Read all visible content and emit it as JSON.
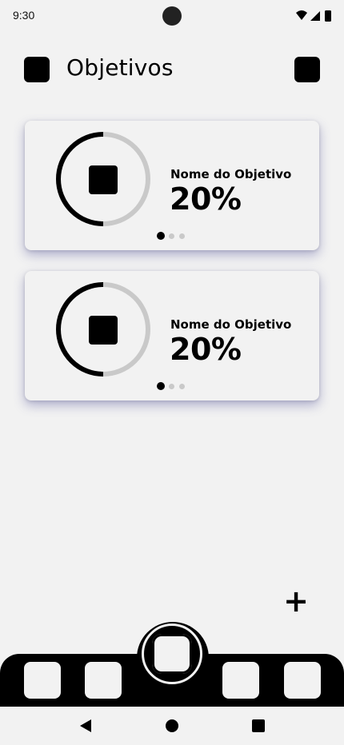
{
  "status_bar": {
    "time": "9:30",
    "icons": [
      "wifi-icon",
      "signal-icon",
      "battery-icon"
    ]
  },
  "header": {
    "title": "Objetivos",
    "menu_icon": "square-icon",
    "action_icon": "square-icon"
  },
  "goals": [
    {
      "name": "Nome do Objetivo",
      "percent_label": "20%",
      "progress": 0.2,
      "icon": "square-icon",
      "dots": {
        "count": 3,
        "active": 0
      }
    },
    {
      "name": "Nome do Objetivo",
      "percent_label": "20%",
      "progress": 0.2,
      "icon": "square-icon",
      "dots": {
        "count": 3,
        "active": 0
      }
    }
  ],
  "add_button": {
    "label": "+"
  },
  "bottom_nav": {
    "items": [
      "nav-item-1",
      "nav-item-2",
      "nav-item-3",
      "nav-item-4"
    ],
    "center_button": "center-square-icon"
  },
  "system_nav": [
    "back-icon",
    "home-icon",
    "recents-icon"
  ],
  "colors": {
    "background": "#f2f2f2",
    "primary": "#000000",
    "ring_track": "#c9c9c9",
    "card_shadow": "#4646a0"
  }
}
